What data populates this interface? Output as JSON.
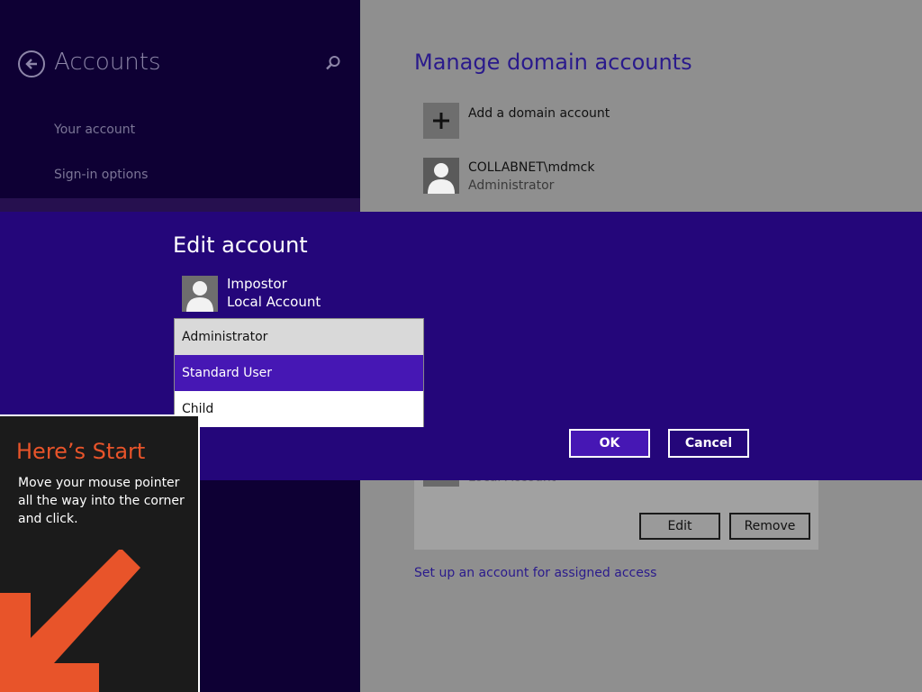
{
  "sidebar": {
    "title": "Accounts",
    "items": [
      {
        "label": "Your account"
      },
      {
        "label": "Sign-in options"
      }
    ]
  },
  "main": {
    "title": "Manage domain accounts",
    "add_label": "Add a domain account",
    "accounts": [
      {
        "name": "COLLABNET\\mdmck",
        "role": "Administrator"
      }
    ],
    "partial_local_label": "Local Account",
    "edit_label": "Edit",
    "remove_label": "Remove",
    "assigned_access_link": "Set up an account for assigned access"
  },
  "dialog": {
    "title": "Edit account",
    "account_name": "Impostor",
    "account_type": "Local Account",
    "options": [
      {
        "label": "Administrator"
      },
      {
        "label": "Standard User"
      },
      {
        "label": "Child"
      }
    ],
    "selected_option": "Standard User",
    "ok_label": "OK",
    "cancel_label": "Cancel"
  },
  "tip": {
    "title": "Here’s Start",
    "body": "Move your mouse pointer all the way into the corner and click."
  },
  "colors": {
    "nav_background": "#0e0034",
    "dialog_background": "#24067a",
    "accent": "#4617b4",
    "tip_title": "#e8542a"
  },
  "icons": [
    "back-arrow-icon",
    "search-icon",
    "plus-icon",
    "user-icon",
    "corner-arrow-icon"
  ]
}
